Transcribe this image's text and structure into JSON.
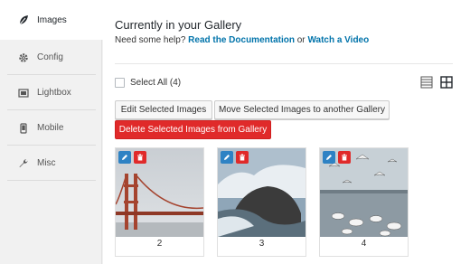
{
  "sidebar": {
    "tabs": [
      {
        "label": "Images",
        "icon": "leaf-icon"
      },
      {
        "label": "Config",
        "icon": "gear-icon"
      },
      {
        "label": "Lightbox",
        "icon": "image-icon"
      },
      {
        "label": "Mobile",
        "icon": "phone-icon"
      },
      {
        "label": "Misc",
        "icon": "wrench-icon"
      }
    ]
  },
  "main": {
    "title": "Currently in your Gallery",
    "help_prefix": "Need some help?",
    "help_link1": "Read the Documentation",
    "help_or": "or",
    "help_link2": "Watch a Video",
    "select_all_label": "Select All (4)",
    "buttons": {
      "edit_selected": "Edit Selected Images",
      "move_selected": "Move Selected Images to another Gallery",
      "delete_selected": "Delete Selected Images from Gallery"
    },
    "images": [
      {
        "number": "2",
        "subject": "bridge"
      },
      {
        "number": "3",
        "subject": "waves"
      },
      {
        "number": "4",
        "subject": "birds"
      }
    ]
  },
  "colors": {
    "accent_blue": "#2e82c4",
    "danger_red": "#e02a2a",
    "link": "#0073aa"
  }
}
